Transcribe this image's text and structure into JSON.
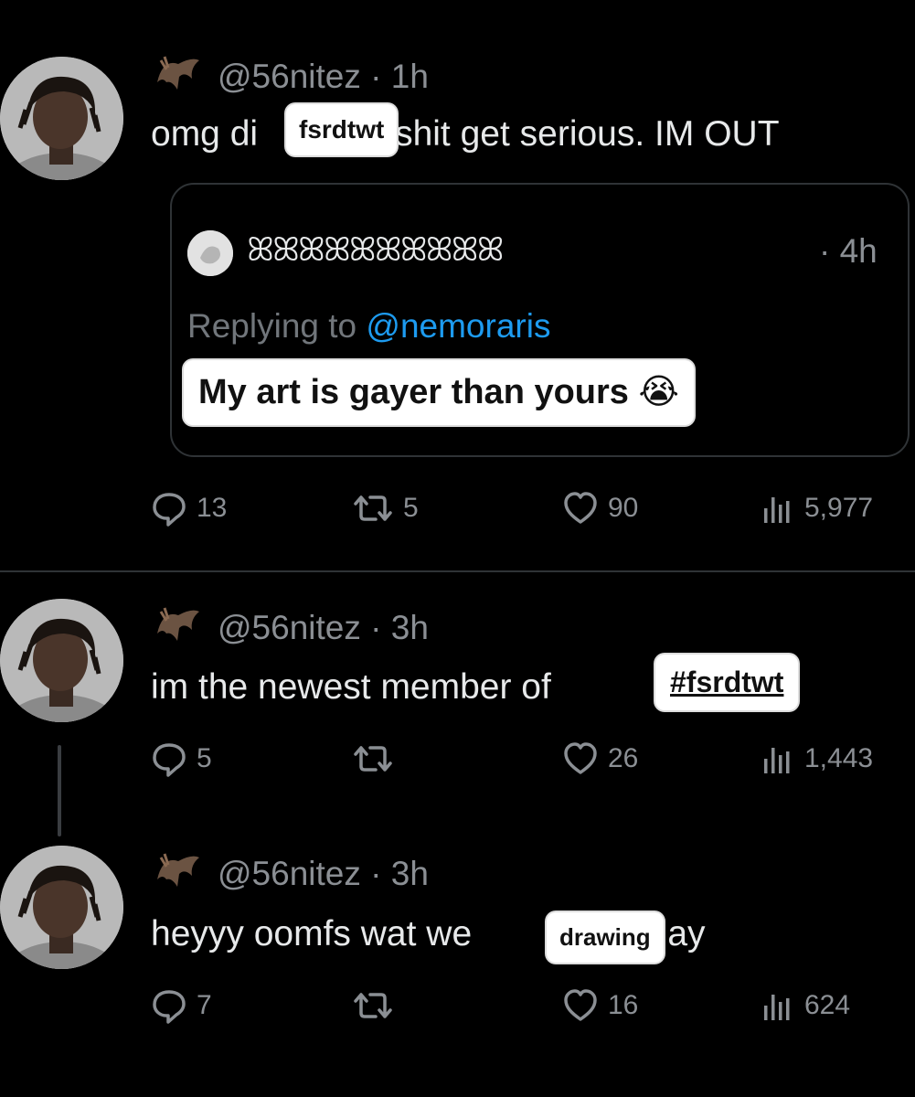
{
  "tweets": [
    {
      "handle": "@56nitez · 1h",
      "text_before": "omg di",
      "sticker": "fsrdtwt",
      "text_after": "shit get serious. IM OUT",
      "quote": {
        "name": "ꕤꕤꕤꕤꕤꕤꕤꕤꕤꕤ",
        "time": "· 4h",
        "replying_label": "Replying to",
        "replying_handle": "@nemoraris",
        "sticker": "My art is gayer than yours",
        "emoji": "😭"
      },
      "actions": {
        "replies": "13",
        "retweets": "5",
        "likes": "90",
        "views": "5,977"
      }
    },
    {
      "handle": "@56nitez · 3h",
      "text_before": "im the newest member of",
      "sticker": "#fsrdtwt",
      "actions": {
        "replies": "5",
        "retweets": "",
        "likes": "26",
        "views": "1,443"
      }
    },
    {
      "handle": "@56nitez · 3h",
      "text_before": "heyyy oomfs wat we",
      "sticker": "drawing",
      "text_after": "today",
      "actions": {
        "replies": "7",
        "retweets": "",
        "likes": "16",
        "views": "624"
      }
    }
  ],
  "colors": {
    "background": "#000000",
    "text": "#e7e9ea",
    "muted": "#8b8f94",
    "link": "#1d9bf0",
    "border": "#2f3336"
  },
  "icons": [
    "bat-icon",
    "reply-icon",
    "retweet-icon",
    "like-icon",
    "views-icon"
  ]
}
